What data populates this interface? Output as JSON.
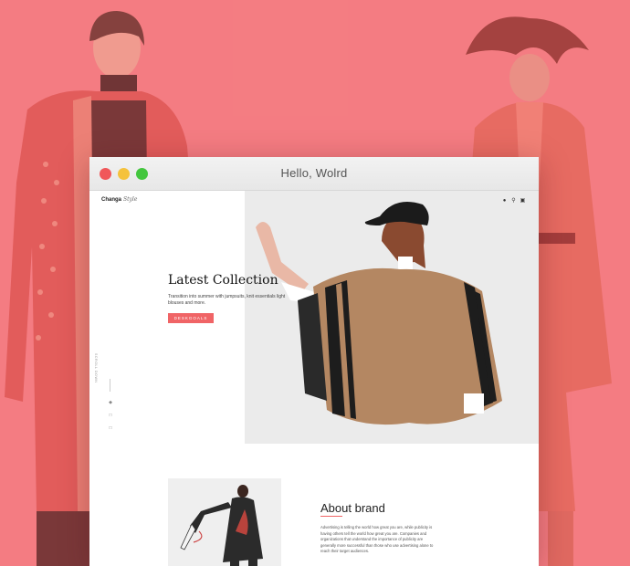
{
  "colors": {
    "background": "#f4858a",
    "accent": "#f06466",
    "window_bg": "#ffffff"
  },
  "window": {
    "title": "Hello, Wolrd",
    "controls": [
      "close",
      "minimize",
      "maximize"
    ]
  },
  "site": {
    "logo": {
      "brand": "Changa",
      "script": "Style"
    },
    "header_icons": [
      "user-icon",
      "search-icon",
      "cart-icon"
    ],
    "hero": {
      "title": "Latest Collection",
      "subtitle": "Transition into summer with jumpsuits, knit essentials light blouses and more.",
      "button_label": "DESKGOALS",
      "scroll_label": "SCROLL DOWN",
      "social_icons": [
        "twitter-icon",
        "instagram-icon",
        "linkedin-icon"
      ]
    },
    "about": {
      "title": "About brand",
      "body": "Advertising is telling the world how great you are, while publicity is having others tell the world how great you are. Companies and organizations that understand the importance of publicity are generally more successful than those who use advertising alone to reach their target audiences."
    }
  }
}
